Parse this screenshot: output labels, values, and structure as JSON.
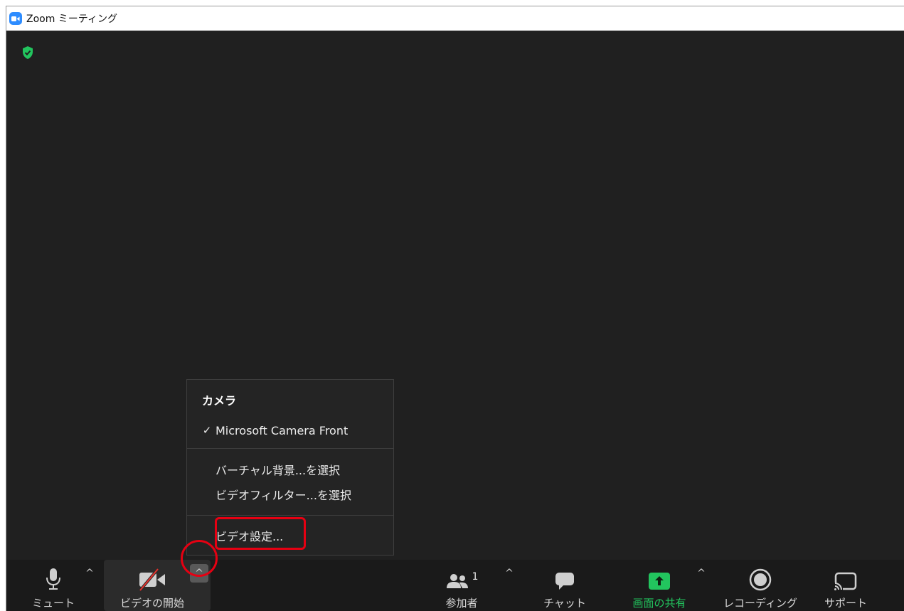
{
  "window": {
    "title": "Zoom ミーティング"
  },
  "menu": {
    "header": "カメラ",
    "camera_item": {
      "check": "✓",
      "label": "Microsoft Camera Front"
    },
    "virtual_bg": "バーチャル背景...を選択",
    "video_filter": "ビデオフィルター...を選択",
    "video_settings": "ビデオ設定..."
  },
  "toolbar": {
    "mute_label": "ミュート",
    "video_label": "ビデオの開始",
    "participants_label": "参加者",
    "participants_count": "1",
    "chat_label": "チャット",
    "share_label": "画面の共有",
    "record_label": "レコーディング",
    "support_label": "サポート"
  },
  "colors": {
    "accent_green": "#22c55e",
    "highlight_red": "#e60012",
    "zoom_blue": "#2d8cff"
  }
}
